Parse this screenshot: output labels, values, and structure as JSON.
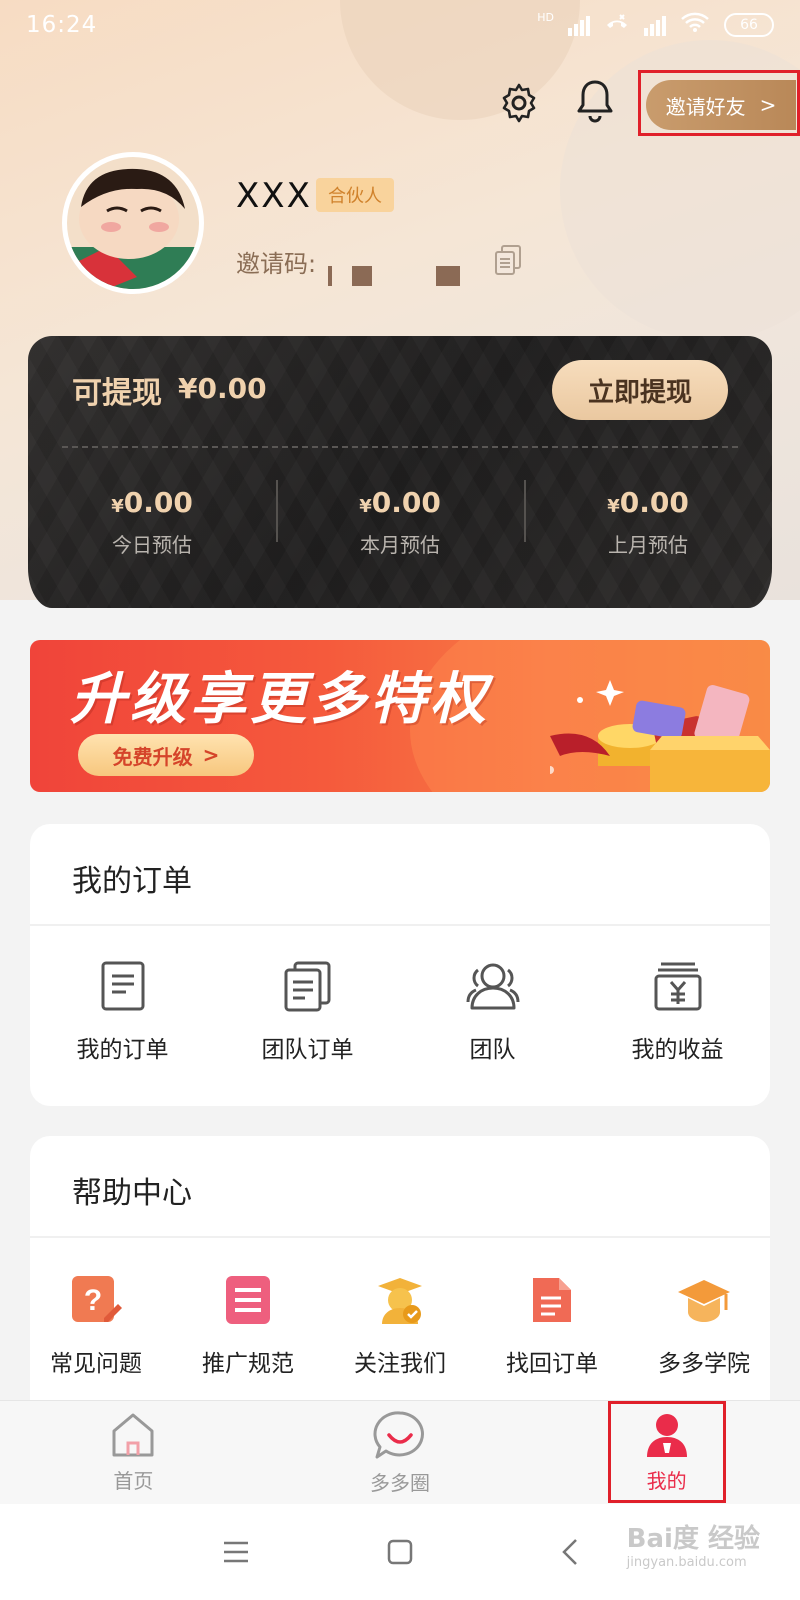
{
  "status_bar": {
    "time": "16:24",
    "network": "HD",
    "battery": "66"
  },
  "header": {
    "invite_label": "邀请好友",
    "invite_chevron": ">"
  },
  "profile": {
    "username": "XXX",
    "role_badge": "合伙人",
    "invite_code_label": "邀请码:"
  },
  "earnings": {
    "withdrawable_label": "可提现",
    "withdrawable_value": "¥0.00",
    "withdraw_button": "立即提现",
    "stats": [
      {
        "currency": "¥",
        "value": "0.00",
        "label": "今日预估"
      },
      {
        "currency": "¥",
        "value": "0.00",
        "label": "本月预估"
      },
      {
        "currency": "¥",
        "value": "0.00",
        "label": "上月预估"
      }
    ]
  },
  "banner": {
    "title": "升级享更多特权",
    "button": "免费升级",
    "button_chevron": ">"
  },
  "orders": {
    "title": "我的订单",
    "items": [
      {
        "label": "我的订单",
        "icon": "document-icon"
      },
      {
        "label": "团队订单",
        "icon": "documents-icon"
      },
      {
        "label": "团队",
        "icon": "team-icon"
      },
      {
        "label": "我的收益",
        "icon": "income-icon"
      }
    ]
  },
  "help": {
    "title": "帮助中心",
    "items": [
      {
        "label": "常见问题",
        "icon": "faq-icon",
        "color": "#f07a52"
      },
      {
        "label": "推广规范",
        "icon": "rules-icon",
        "color": "#ee5f7e"
      },
      {
        "label": "关注我们",
        "icon": "follow-icon",
        "color": "#f2b23a"
      },
      {
        "label": "找回订单",
        "icon": "retrieve-order-icon",
        "color": "#f06a55"
      },
      {
        "label": "多多学院",
        "icon": "academy-icon",
        "color": "#f39a3a"
      }
    ]
  },
  "tabbar": {
    "items": [
      {
        "label": "首页",
        "icon": "home-icon"
      },
      {
        "label": "多多圈",
        "icon": "circle-icon"
      },
      {
        "label": "我的",
        "icon": "profile-icon"
      }
    ],
    "active_color": "#ea2c4a"
  },
  "watermark": {
    "brand": "Bai度 经验",
    "url": "jingyan.baidu.com"
  }
}
